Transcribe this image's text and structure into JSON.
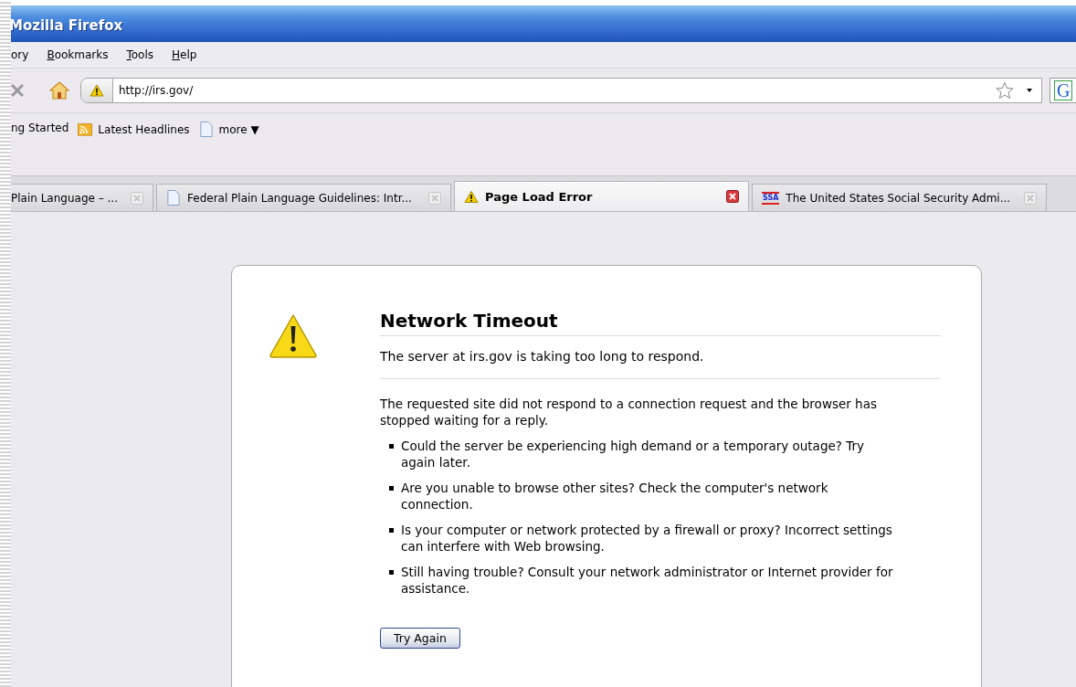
{
  "window": {
    "title": "Mozilla Firefox"
  },
  "menu": [
    {
      "label": "ory",
      "mnemonic": false
    },
    {
      "label": "Bookmarks",
      "mnemonic": true
    },
    {
      "label": "Tools",
      "mnemonic": true
    },
    {
      "label": "Help",
      "mnemonic": true
    }
  ],
  "toolbar": {
    "url": "http://irs.gov/",
    "search_engine": "G"
  },
  "bookmarks": [
    {
      "label": "ng Started",
      "kind": "plain"
    },
    {
      "label": "Latest Headlines",
      "kind": "feed"
    },
    {
      "label": "more ▼",
      "kind": "page"
    }
  ],
  "tabs": [
    {
      "title": "Plain Language – ...",
      "kind": "plain",
      "selected": false
    },
    {
      "title": "Federal Plain Language Guidelines: Intr...",
      "kind": "page",
      "selected": false
    },
    {
      "title": "Page Load Error",
      "kind": "warning",
      "selected": true
    },
    {
      "title": "The United States Social Security Admi...",
      "kind": "logo",
      "icon_text": "SSA",
      "selected": false
    }
  ],
  "error": {
    "title": "Network Timeout",
    "short_desc": "The server at irs.gov is taking too long to respond.",
    "long_desc": "The requested site did not respond to a connection request and the browser has stopped waiting for a reply.",
    "bullets": [
      "Could the server be experiencing high demand or a temporary outage? Try again later.",
      "Are you unable to browse other sites? Check the computer's network connection.",
      "Is your computer or network protected by a firewall or proxy? Incorrect settings can interfere with Web browsing.",
      "Still having trouble? Consult your network administrator or Internet provider for assistance."
    ],
    "button": "Try Again"
  }
}
